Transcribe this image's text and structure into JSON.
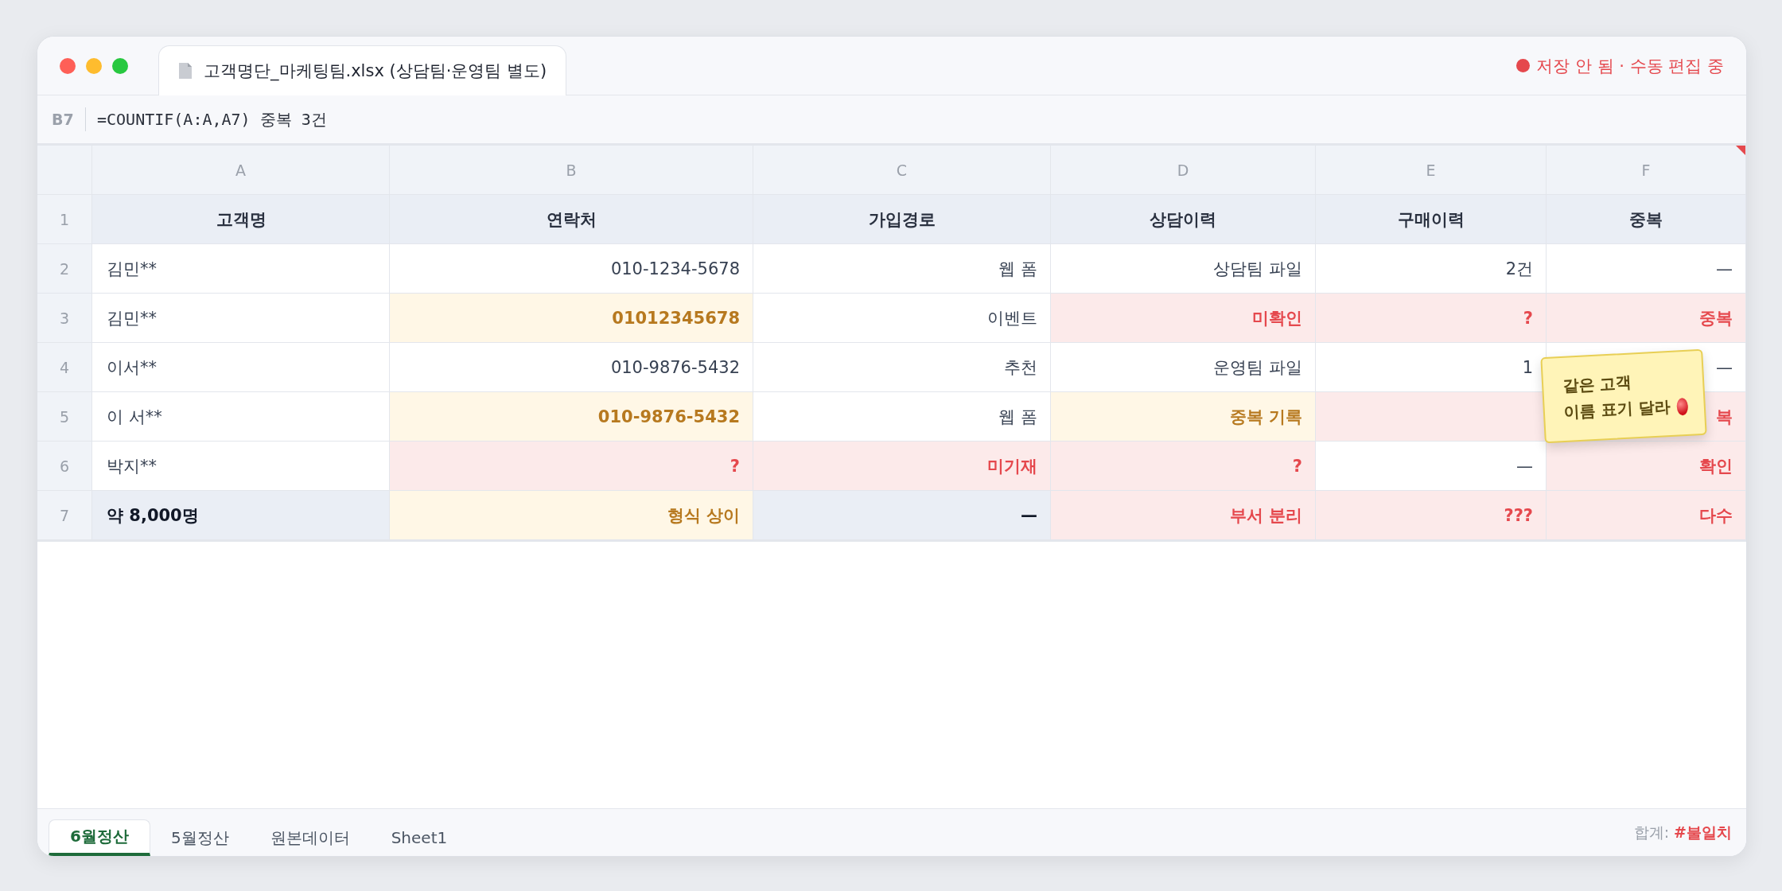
{
  "window": {
    "title": "고객명단_마케팅팀.xlsx (상담팀·운영팀 별도)",
    "status": "저장 안 됨 · 수동 편집 중"
  },
  "formula_bar": {
    "cell": "B7",
    "formula": "=COUNTIF(A:A,A7) 중복 3건"
  },
  "table": {
    "columns": [
      "A",
      "B",
      "C",
      "D",
      "E",
      "F"
    ],
    "rows": [
      {
        "number": "1",
        "cells": [
          {
            "text": "고객명",
            "kind": "header"
          },
          {
            "text": "연락처",
            "kind": "header"
          },
          {
            "text": "가입경로",
            "kind": "header"
          },
          {
            "text": "상담이력",
            "kind": "header"
          },
          {
            "text": "구매이력",
            "kind": "header"
          },
          {
            "text": "중복",
            "kind": "header",
            "comment": true
          }
        ]
      },
      {
        "number": "2",
        "cells": [
          {
            "text": "김민**",
            "kind": "normal"
          },
          {
            "text": "010-1234-5678",
            "kind": "normal"
          },
          {
            "text": "웹 폼",
            "kind": "normal"
          },
          {
            "text": "상담팀 파일",
            "kind": "normal"
          },
          {
            "text": "2건",
            "kind": "normal"
          },
          {
            "text": "—",
            "kind": "normal"
          }
        ]
      },
      {
        "number": "3",
        "cells": [
          {
            "text": "김민**",
            "kind": "normal"
          },
          {
            "text": "01012345678",
            "kind": "warn"
          },
          {
            "text": "이벤트",
            "kind": "normal"
          },
          {
            "text": "미확인",
            "kind": "error"
          },
          {
            "text": "?",
            "kind": "error"
          },
          {
            "text": "중복",
            "kind": "error"
          }
        ]
      },
      {
        "number": "4",
        "cells": [
          {
            "text": "이서**",
            "kind": "normal"
          },
          {
            "text": "010-9876-5432",
            "kind": "normal"
          },
          {
            "text": "추천",
            "kind": "normal"
          },
          {
            "text": "운영팀 파일",
            "kind": "normal"
          },
          {
            "text": "1",
            "kind": "normal"
          },
          {
            "text": "—",
            "kind": "normal"
          }
        ]
      },
      {
        "number": "5",
        "cells": [
          {
            "text": "이 서**",
            "kind": "normal"
          },
          {
            "text": "010-9876-5432",
            "kind": "warn"
          },
          {
            "text": "웹 폼",
            "kind": "normal"
          },
          {
            "text": "중복 기록",
            "kind": "warn"
          },
          {
            "kind": "error"
          },
          {
            "text": "복",
            "kind": "error"
          }
        ]
      },
      {
        "number": "6",
        "cells": [
          {
            "text": "박지**",
            "kind": "normal"
          },
          {
            "text": "?",
            "kind": "error"
          },
          {
            "text": "미기재",
            "kind": "error"
          },
          {
            "text": "?",
            "kind": "error"
          },
          {
            "text": "—",
            "kind": "normal"
          },
          {
            "text": "확인",
            "kind": "error"
          }
        ]
      },
      {
        "number": "7",
        "cells": [
          {
            "text": "약 8,000명",
            "kind": "total"
          },
          {
            "text": "형식 상이",
            "kind": "warn"
          },
          {
            "text": "—",
            "kind": "total"
          },
          {
            "text": "부서 분리",
            "kind": "error"
          },
          {
            "text": "???",
            "kind": "error"
          },
          {
            "text": "다수",
            "kind": "error"
          }
        ]
      }
    ]
  },
  "sticky_note": {
    "lines": [
      "같은 고객",
      "이름 표기 달라"
    ]
  },
  "sheet_tabs": [
    {
      "label": "6월정산",
      "selected": true
    },
    {
      "label": "5월정산",
      "selected": false
    },
    {
      "label": "원본데이터",
      "selected": false
    },
    {
      "label": "Sheet1",
      "selected": false
    }
  ],
  "status_bar": {
    "label": "합계:",
    "value": "#불일치"
  }
}
